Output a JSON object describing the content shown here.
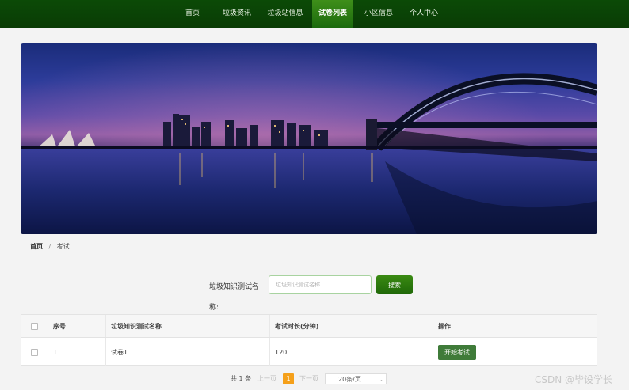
{
  "nav": {
    "items": [
      {
        "label": "首页",
        "active": false
      },
      {
        "label": "垃圾资讯",
        "active": false
      },
      {
        "label": "垃圾站信息",
        "active": false
      },
      {
        "label": "试卷列表",
        "active": true
      },
      {
        "label": "小区信息",
        "active": false
      },
      {
        "label": "个人中心",
        "active": false
      }
    ]
  },
  "carousel": {
    "slide_count": 3,
    "active_index": 0
  },
  "breadcrumb": {
    "home": "首页",
    "separator": "/",
    "current": "考试"
  },
  "search": {
    "label": "垃圾知识测试名称:",
    "placeholder": "垃圾知识测试名称",
    "value": "",
    "button_label": "搜索"
  },
  "table": {
    "headers": [
      "序号",
      "垃圾知识测试名称",
      "考试时长(分钟)",
      "操作"
    ],
    "rows": [
      {
        "index": "1",
        "name": "试卷1",
        "duration": "120",
        "action_label": "开始考试"
      }
    ]
  },
  "pagination": {
    "total": "共 1 条",
    "prev": "上一页",
    "current_page": "1",
    "next": "下一页",
    "page_size": "20条/页"
  },
  "watermark": "CSDN @毕设学长",
  "colors": {
    "nav_bg": "#0b4a06",
    "accent_green": "#2d7a10",
    "pager_active": "#f5a01a"
  }
}
